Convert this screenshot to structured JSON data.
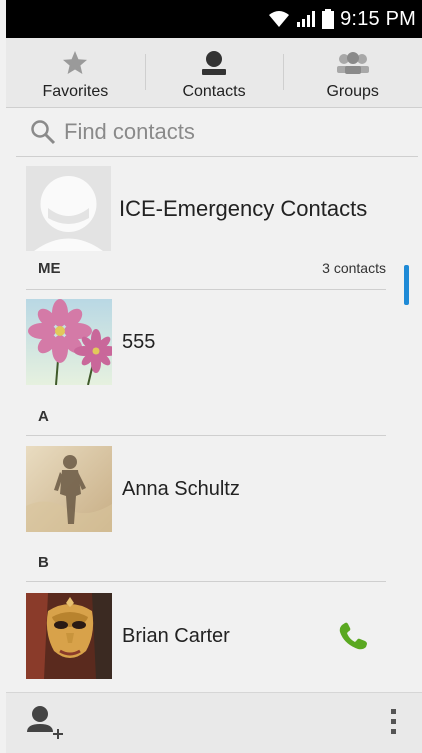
{
  "status_bar": {
    "time": "9:15 PM"
  },
  "tabs": [
    {
      "label": "Favorites",
      "icon": "star-icon"
    },
    {
      "label": "Contacts",
      "icon": "person-icon"
    },
    {
      "label": "Groups",
      "icon": "group-icon"
    }
  ],
  "search": {
    "placeholder": "Find contacts"
  },
  "ice": {
    "label": "ICE-Emergency Contacts"
  },
  "sections": [
    {
      "letter": "ME",
      "count": "3 contacts"
    },
    {
      "letter": "A"
    },
    {
      "letter": "B"
    }
  ],
  "contacts": [
    {
      "name": "555",
      "photo": "flowers"
    },
    {
      "name": "Anna Schultz",
      "photo": "shadow"
    },
    {
      "name": "Brian Carter",
      "photo": "mask"
    }
  ],
  "colors": {
    "accent": "#1f8ad6",
    "call_green": "#5aa821"
  }
}
